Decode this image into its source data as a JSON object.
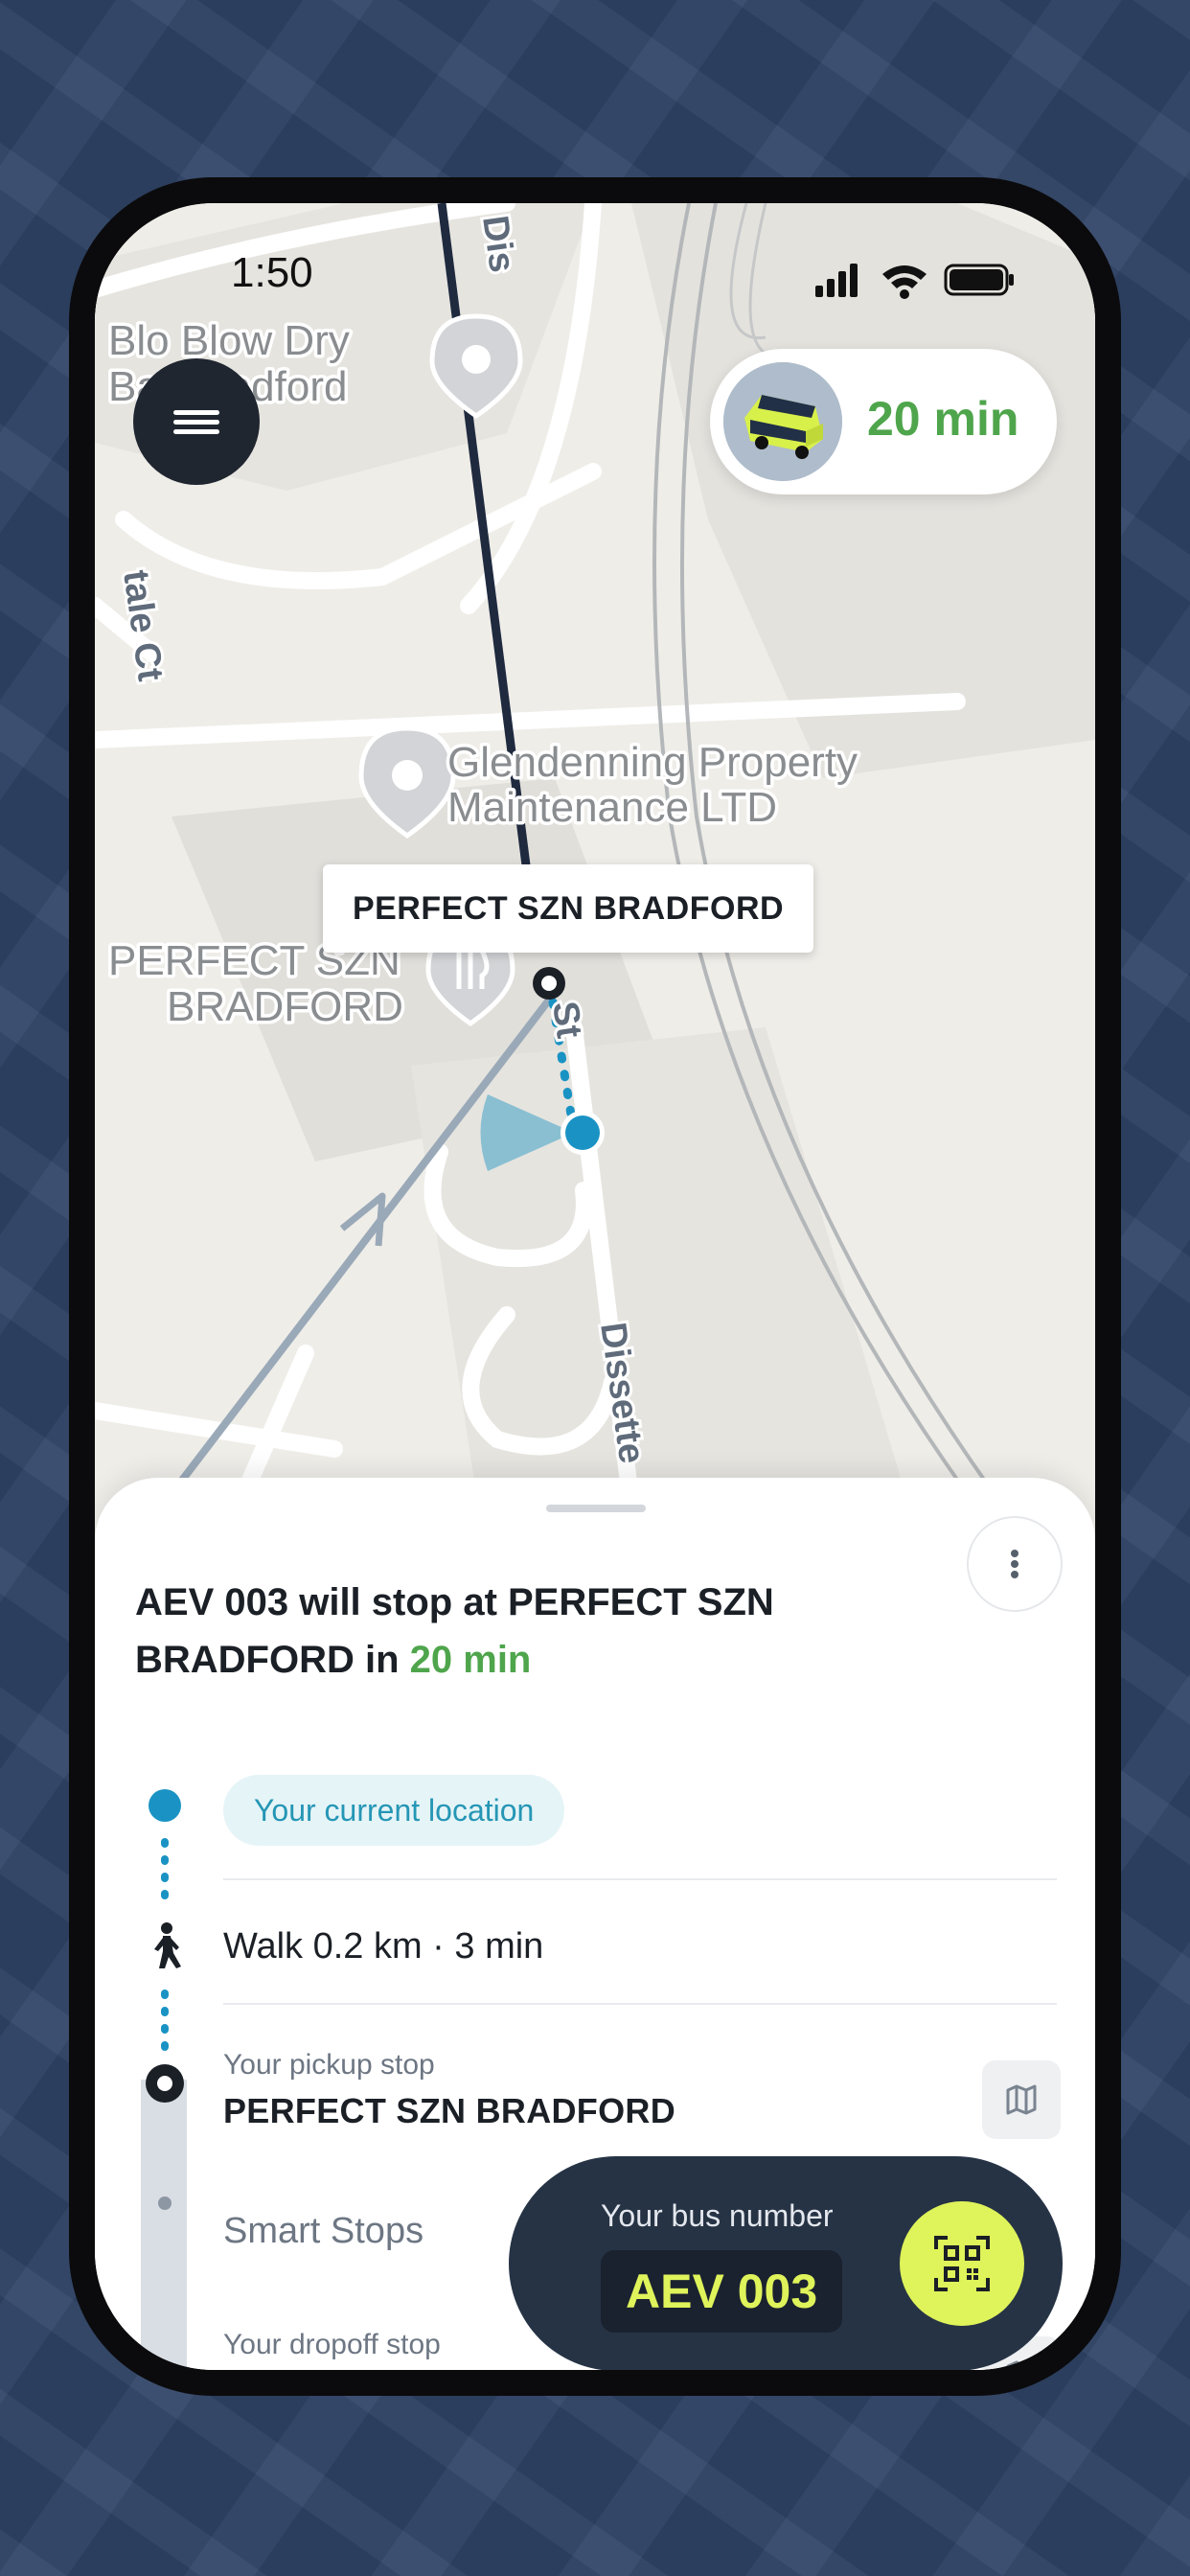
{
  "status_bar": {
    "time": "1:50"
  },
  "map": {
    "poi_blo_blow": [
      "Blo Blow Dry",
      "Bar Bradford"
    ],
    "poi_glendenning": [
      "Glendenning Property",
      "Maintenance LTD"
    ],
    "poi_perfect_szn": [
      "PERFECT SZN",
      "BRADFORD"
    ],
    "road_top": "Dis",
    "road_bottom": "Dissette",
    "road_side": "tale Ct",
    "road_mid": "St",
    "stop_label": "PERFECT SZN BRADFORD"
  },
  "eta_pill": {
    "text": "20 min"
  },
  "sheet": {
    "headline_prefix": "AEV 003 will stop at PERFECT SZN BRADFORD in ",
    "headline_eta": "20 min",
    "current_location": "Your current location",
    "walk": "Walk 0.2 km · 3 min",
    "pickup_label": "Your pickup stop",
    "pickup_name": "PERFECT SZN BRADFORD",
    "smart_stops": "Smart Stops",
    "dropoff_label": "Your dropoff stop"
  },
  "bus_card": {
    "caption": "Your bus number",
    "number": "AEV 003"
  },
  "colors": {
    "accent_green": "#4fa54c",
    "accent_lime": "#dff35a",
    "accent_blue": "#1a93c4",
    "dark": "#263345"
  }
}
